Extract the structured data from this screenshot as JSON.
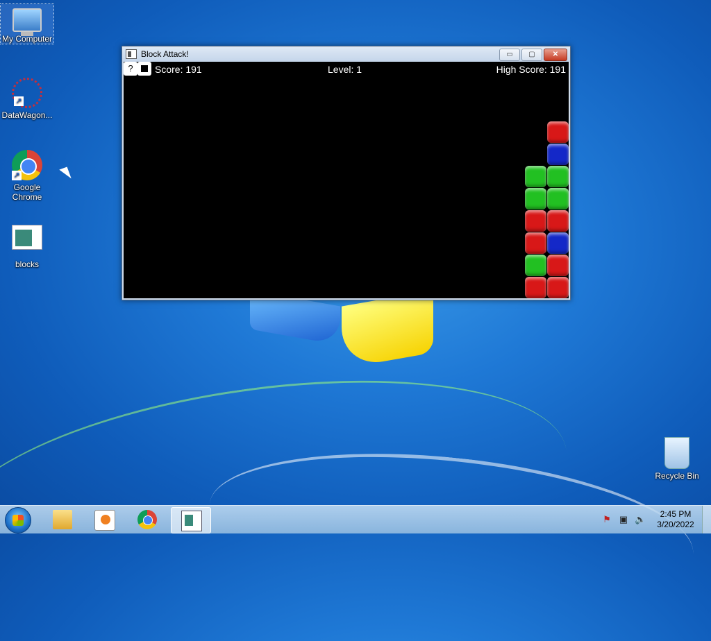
{
  "desktop": {
    "icons": [
      {
        "label": "My Computer"
      },
      {
        "label": "DataWagon..."
      },
      {
        "label": "Google Chrome"
      },
      {
        "label": "blocks"
      },
      {
        "label": "Recycle Bin"
      }
    ]
  },
  "window": {
    "title": "Block Attack!",
    "minimize_glyph": "▭",
    "maximize_glyph": "▢",
    "close_glyph": "✕"
  },
  "game": {
    "help_label": "?",
    "score_text": "Score: 191",
    "level_text": "Level: 1",
    "highscore_text": "High Score: 191",
    "colors": {
      "red": "#d81818",
      "green": "#22c022",
      "blue": "#1428c8"
    },
    "grid": [
      {
        "row": 0,
        "col": 1,
        "color": "red"
      },
      {
        "row": 1,
        "col": 1,
        "color": "blue"
      },
      {
        "row": 2,
        "col": 0,
        "color": "green"
      },
      {
        "row": 2,
        "col": 1,
        "color": "green"
      },
      {
        "row": 3,
        "col": 0,
        "color": "green"
      },
      {
        "row": 3,
        "col": 1,
        "color": "green"
      },
      {
        "row": 4,
        "col": 0,
        "color": "red"
      },
      {
        "row": 4,
        "col": 1,
        "color": "red"
      },
      {
        "row": 5,
        "col": 0,
        "color": "red"
      },
      {
        "row": 5,
        "col": 1,
        "color": "blue"
      },
      {
        "row": 6,
        "col": 0,
        "color": "green"
      },
      {
        "row": 6,
        "col": 1,
        "color": "red"
      },
      {
        "row": 7,
        "col": 0,
        "color": "red"
      },
      {
        "row": 7,
        "col": 1,
        "color": "red"
      }
    ]
  },
  "taskbar": {
    "items": [
      "windows-explorer",
      "media-player",
      "google-chrome",
      "blocks"
    ],
    "active_item": "blocks",
    "tray": {
      "icons": [
        "action-center-flag-icon",
        "network-icon",
        "volume-icon"
      ],
      "time": "2:45 PM",
      "date": "3/20/2022"
    }
  }
}
